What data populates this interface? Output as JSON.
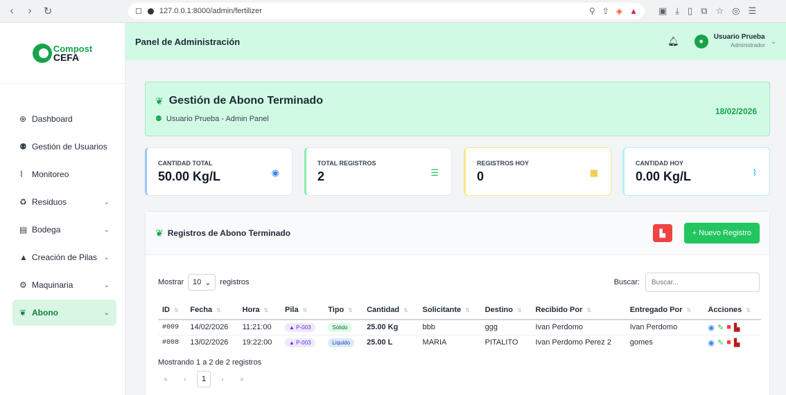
{
  "browser": {
    "url": "127.0.0.1:8000/admin/fertilizer"
  },
  "sidebar": {
    "logo_line1": "Compost",
    "logo_line2": "CEFA",
    "items": [
      {
        "label": "Dashboard",
        "icon": "globe-icon"
      },
      {
        "label": "Gestión de Usuarios",
        "icon": "users-icon"
      },
      {
        "label": "Monitoreo",
        "icon": "chart-line-icon"
      },
      {
        "label": "Residuos",
        "icon": "recycle-icon"
      },
      {
        "label": "Bodega",
        "icon": "warehouse-icon"
      },
      {
        "label": "Creación de Pilas",
        "icon": "mountain-icon"
      },
      {
        "label": "Maquinaria",
        "icon": "gears-icon"
      },
      {
        "label": "Abono",
        "icon": "seedling-icon"
      }
    ]
  },
  "header": {
    "title": "Panel de Administración",
    "user_name": "Usuario Prueba",
    "user_role": "Administrador"
  },
  "banner": {
    "title": "Gestión de Abono Terminado",
    "subtitle": "Usuario Prueba - Admin Panel",
    "date": "18/02/2026"
  },
  "stats": [
    {
      "label": "CANTIDAD TOTAL",
      "value": "50.00 Kg/L"
    },
    {
      "label": "TOTAL REGISTROS",
      "value": "2"
    },
    {
      "label": "REGISTROS HOY",
      "value": "0"
    },
    {
      "label": "CANTIDAD HOY",
      "value": "0.00 Kg/L"
    }
  ],
  "card": {
    "title": "Registros de Abono Terminado",
    "new_button": "+ Nuevo Registro"
  },
  "controls": {
    "show_label": "Mostrar",
    "page_size": "10",
    "records_label": "registros",
    "search_label": "Buscar:",
    "search_placeholder": "Buscar..."
  },
  "table": {
    "headers": [
      "ID",
      "Fecha",
      "Hora",
      "Pila",
      "Tipo",
      "Cantidad",
      "Solicitante",
      "Destino",
      "Recibido Por",
      "Entregado Por",
      "Acciones"
    ],
    "rows": [
      {
        "id": "#009",
        "fecha": "14/02/2026",
        "hora": "11:21:00",
        "pila": "P-003",
        "tipo": "Solido",
        "cantidad": "25.00 Kg",
        "solicitante": "bbb",
        "destino": "ggg",
        "recibido": "Ivan Perdomo",
        "entregado": "Ivan Perdomo"
      },
      {
        "id": "#008",
        "fecha": "13/02/2026",
        "hora": "19:22:00",
        "pila": "P-003",
        "tipo": "Liquido",
        "cantidad": "25.00 L",
        "solicitante": "MARIA",
        "destino": "PITALITO",
        "recibido": "Ivan Perdomo Perez 2",
        "entregado": "gomes"
      }
    ]
  },
  "footer": {
    "info": "Mostrando 1 a 2 de 2 registros",
    "current_page": "1"
  }
}
